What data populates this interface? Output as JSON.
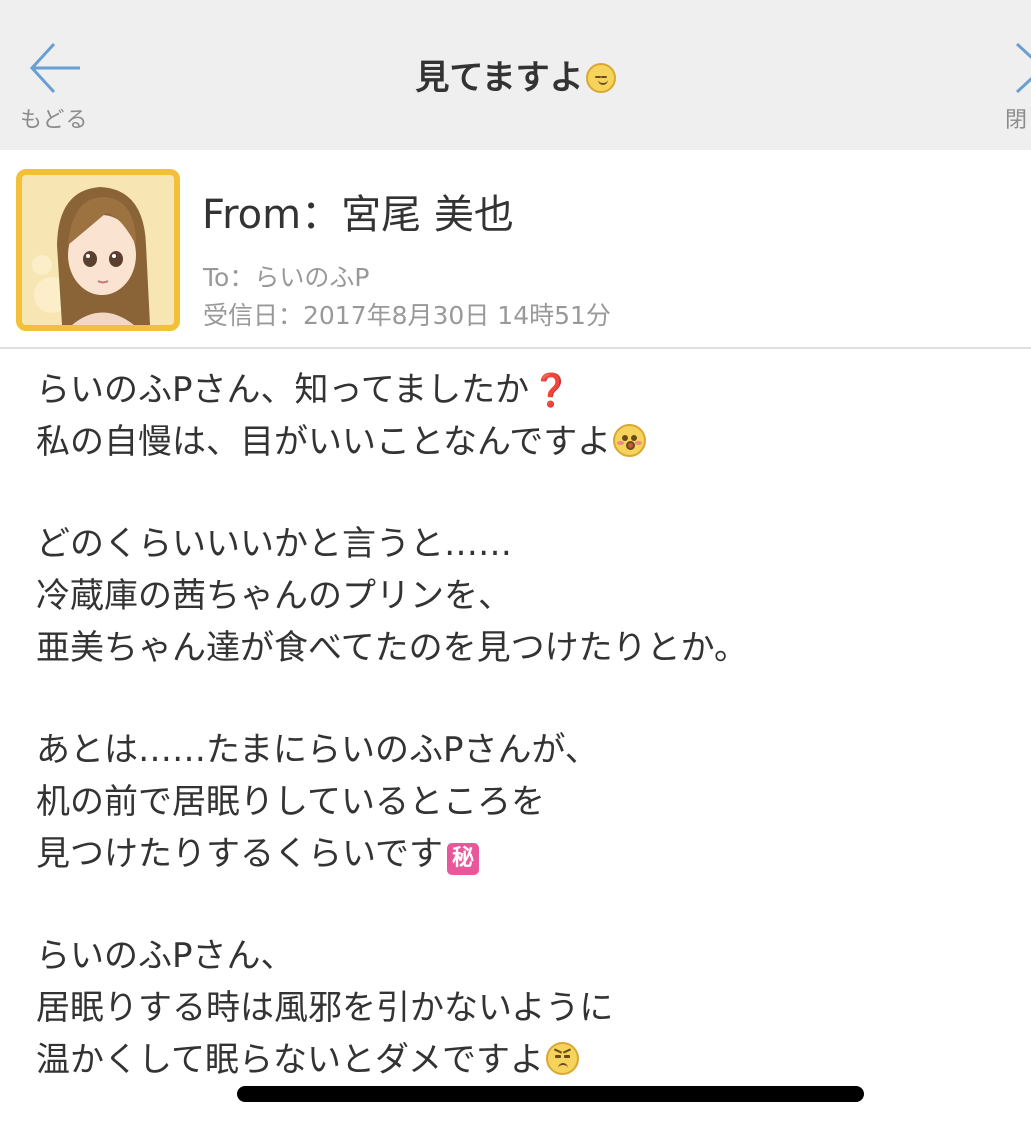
{
  "header": {
    "back_label": "もどる",
    "title": "見てますよ",
    "title_emoji": "smirk-face-emoji",
    "close_label": "閉"
  },
  "sender": {
    "from": "From：宮尾 美也",
    "to": "To：らいのふP",
    "date": "受信日：2017年8月30日 14時51分"
  },
  "message": {
    "paragraphs": [
      [
        "らいのふPさん、知ってましたか",
        "私の自慢は、目がいいことなんですよ"
      ],
      [
        "どのくらいいいかと言うと……",
        "冷蔵庫の茜ちゃんのプリンを、",
        "亜美ちゃん達が食べてたのを見つけたりとか。"
      ],
      [
        "あとは……たまにらいのふPさんが、",
        "机の前で居眠りしているところを",
        "見つけたりするくらいです"
      ],
      [
        "らいのふPさん、",
        "居眠りする時は風邪を引かないように",
        "温かくして眠らないとダメですよ"
      ]
    ],
    "emoji": {
      "question": "❓",
      "secret": "秘"
    }
  },
  "colors": {
    "header_bg": "#efefef",
    "back_icon": "#6a9fd3",
    "avatar_border": "#f3c03a",
    "meta_text": "#999999"
  }
}
